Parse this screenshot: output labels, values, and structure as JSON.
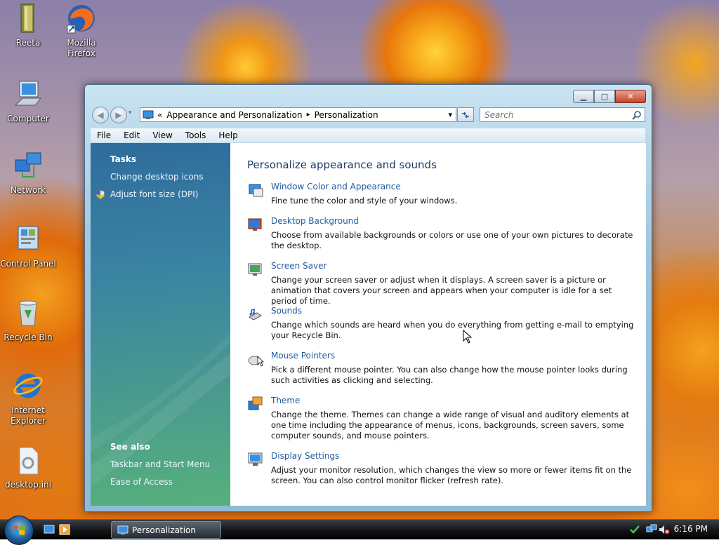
{
  "desktop": {
    "icons": [
      {
        "label": "Reeta",
        "icon": "folder-icon"
      },
      {
        "label": "Mozilla Firefox",
        "icon": "firefox-icon"
      },
      {
        "label": "Computer",
        "icon": "computer-icon"
      },
      {
        "label": "Network",
        "icon": "network-icon"
      },
      {
        "label": "Control Panel",
        "icon": "control-panel-icon"
      },
      {
        "label": "Recycle Bin",
        "icon": "recycle-bin-icon"
      },
      {
        "label": "Internet Explorer",
        "icon": "internet-explorer-icon"
      },
      {
        "label": "desktop.ini",
        "icon": "ini-file-icon"
      }
    ]
  },
  "window": {
    "caption_buttons": {
      "minimize": "▁",
      "maximize": "□",
      "close": "✕"
    },
    "address": {
      "chevron": "«",
      "crumbs": [
        "Appearance and Personalization",
        "Personalization"
      ],
      "separator": "▸",
      "dropdown": "▾"
    },
    "search": {
      "placeholder": "Search"
    },
    "menu": [
      "File",
      "Edit",
      "View",
      "Tools",
      "Help"
    ],
    "tasks": {
      "heading": "Tasks",
      "links": [
        "Change desktop icons",
        "Adjust font size (DPI)"
      ]
    },
    "see_also": {
      "heading": "See also",
      "links": [
        "Taskbar and Start Menu",
        "Ease of Access"
      ]
    },
    "main": {
      "title": "Personalize appearance and sounds",
      "items": [
        {
          "link": "Window Color and Appearance",
          "desc": "Fine tune the color and style of your windows.",
          "icon": "window-color-icon"
        },
        {
          "link": "Desktop Background",
          "desc": "Choose from available backgrounds or colors or use one of your own pictures to decorate the desktop.",
          "icon": "desktop-background-icon"
        },
        {
          "link": "Screen Saver",
          "desc": "Change your screen saver or adjust when it displays. A screen saver is a picture or animation that covers your screen and appears when your computer is idle for a set period of time.",
          "icon": "screen-saver-icon"
        },
        {
          "link": "Sounds",
          "desc": "Change which sounds are heard when you do everything from getting e-mail to emptying your Recycle Bin.",
          "icon": "sounds-icon"
        },
        {
          "link": "Mouse Pointers",
          "desc": "Pick a different mouse pointer. You can also change how the mouse pointer looks during such activities as clicking and selecting.",
          "icon": "mouse-icon"
        },
        {
          "link": "Theme",
          "desc": "Change the theme. Themes can change a wide range of visual and auditory elements at one time including the appearance of menus, icons, backgrounds, screen savers, some computer sounds, and mouse pointers.",
          "icon": "theme-icon"
        },
        {
          "link": "Display Settings",
          "desc": "Adjust your monitor resolution, which changes the view so more or fewer items fit on the screen. You can also control monitor flicker (refresh rate).",
          "icon": "display-settings-icon"
        }
      ]
    }
  },
  "taskbar": {
    "task_button_label": "Personalization",
    "clock": "6:16 PM"
  }
}
